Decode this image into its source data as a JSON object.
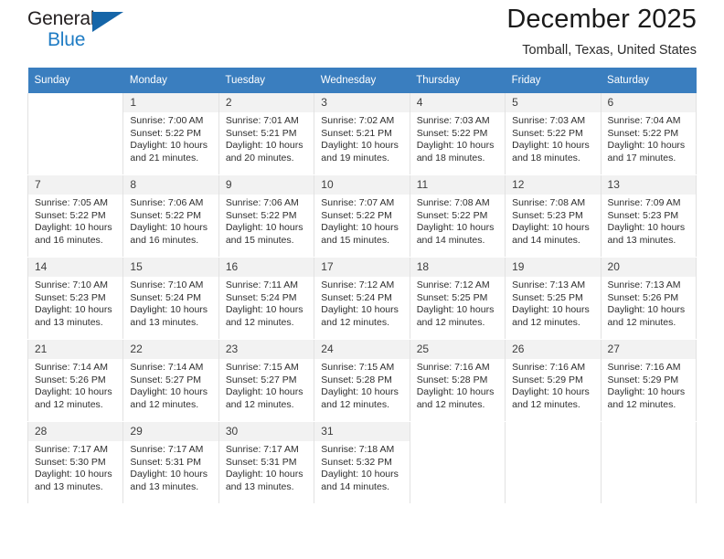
{
  "brand": {
    "name_part1": "General",
    "name_part2": "Blue",
    "triangle_color": "#1565a8",
    "blue_color": "#1f7cc4"
  },
  "header": {
    "title": "December 2025",
    "subtitle": "Tomball, Texas, United States"
  },
  "theme": {
    "header_row_bg": "#3a7ebf",
    "daynum_bg": "#f2f2f2",
    "cell_border": "#e2e2e2"
  },
  "weekday_headers": [
    "Sunday",
    "Monday",
    "Tuesday",
    "Wednesday",
    "Thursday",
    "Friday",
    "Saturday"
  ],
  "weeks": [
    [
      {
        "day": "",
        "sunrise": "",
        "sunset": "",
        "daylight": ""
      },
      {
        "day": "1",
        "sunrise": "Sunrise: 7:00 AM",
        "sunset": "Sunset: 5:22 PM",
        "daylight": "Daylight: 10 hours and 21 minutes."
      },
      {
        "day": "2",
        "sunrise": "Sunrise: 7:01 AM",
        "sunset": "Sunset: 5:21 PM",
        "daylight": "Daylight: 10 hours and 20 minutes."
      },
      {
        "day": "3",
        "sunrise": "Sunrise: 7:02 AM",
        "sunset": "Sunset: 5:21 PM",
        "daylight": "Daylight: 10 hours and 19 minutes."
      },
      {
        "day": "4",
        "sunrise": "Sunrise: 7:03 AM",
        "sunset": "Sunset: 5:22 PM",
        "daylight": "Daylight: 10 hours and 18 minutes."
      },
      {
        "day": "5",
        "sunrise": "Sunrise: 7:03 AM",
        "sunset": "Sunset: 5:22 PM",
        "daylight": "Daylight: 10 hours and 18 minutes."
      },
      {
        "day": "6",
        "sunrise": "Sunrise: 7:04 AM",
        "sunset": "Sunset: 5:22 PM",
        "daylight": "Daylight: 10 hours and 17 minutes."
      }
    ],
    [
      {
        "day": "7",
        "sunrise": "Sunrise: 7:05 AM",
        "sunset": "Sunset: 5:22 PM",
        "daylight": "Daylight: 10 hours and 16 minutes."
      },
      {
        "day": "8",
        "sunrise": "Sunrise: 7:06 AM",
        "sunset": "Sunset: 5:22 PM",
        "daylight": "Daylight: 10 hours and 16 minutes."
      },
      {
        "day": "9",
        "sunrise": "Sunrise: 7:06 AM",
        "sunset": "Sunset: 5:22 PM",
        "daylight": "Daylight: 10 hours and 15 minutes."
      },
      {
        "day": "10",
        "sunrise": "Sunrise: 7:07 AM",
        "sunset": "Sunset: 5:22 PM",
        "daylight": "Daylight: 10 hours and 15 minutes."
      },
      {
        "day": "11",
        "sunrise": "Sunrise: 7:08 AM",
        "sunset": "Sunset: 5:22 PM",
        "daylight": "Daylight: 10 hours and 14 minutes."
      },
      {
        "day": "12",
        "sunrise": "Sunrise: 7:08 AM",
        "sunset": "Sunset: 5:23 PM",
        "daylight": "Daylight: 10 hours and 14 minutes."
      },
      {
        "day": "13",
        "sunrise": "Sunrise: 7:09 AM",
        "sunset": "Sunset: 5:23 PM",
        "daylight": "Daylight: 10 hours and 13 minutes."
      }
    ],
    [
      {
        "day": "14",
        "sunrise": "Sunrise: 7:10 AM",
        "sunset": "Sunset: 5:23 PM",
        "daylight": "Daylight: 10 hours and 13 minutes."
      },
      {
        "day": "15",
        "sunrise": "Sunrise: 7:10 AM",
        "sunset": "Sunset: 5:24 PM",
        "daylight": "Daylight: 10 hours and 13 minutes."
      },
      {
        "day": "16",
        "sunrise": "Sunrise: 7:11 AM",
        "sunset": "Sunset: 5:24 PM",
        "daylight": "Daylight: 10 hours and 12 minutes."
      },
      {
        "day": "17",
        "sunrise": "Sunrise: 7:12 AM",
        "sunset": "Sunset: 5:24 PM",
        "daylight": "Daylight: 10 hours and 12 minutes."
      },
      {
        "day": "18",
        "sunrise": "Sunrise: 7:12 AM",
        "sunset": "Sunset: 5:25 PM",
        "daylight": "Daylight: 10 hours and 12 minutes."
      },
      {
        "day": "19",
        "sunrise": "Sunrise: 7:13 AM",
        "sunset": "Sunset: 5:25 PM",
        "daylight": "Daylight: 10 hours and 12 minutes."
      },
      {
        "day": "20",
        "sunrise": "Sunrise: 7:13 AM",
        "sunset": "Sunset: 5:26 PM",
        "daylight": "Daylight: 10 hours and 12 minutes."
      }
    ],
    [
      {
        "day": "21",
        "sunrise": "Sunrise: 7:14 AM",
        "sunset": "Sunset: 5:26 PM",
        "daylight": "Daylight: 10 hours and 12 minutes."
      },
      {
        "day": "22",
        "sunrise": "Sunrise: 7:14 AM",
        "sunset": "Sunset: 5:27 PM",
        "daylight": "Daylight: 10 hours and 12 minutes."
      },
      {
        "day": "23",
        "sunrise": "Sunrise: 7:15 AM",
        "sunset": "Sunset: 5:27 PM",
        "daylight": "Daylight: 10 hours and 12 minutes."
      },
      {
        "day": "24",
        "sunrise": "Sunrise: 7:15 AM",
        "sunset": "Sunset: 5:28 PM",
        "daylight": "Daylight: 10 hours and 12 minutes."
      },
      {
        "day": "25",
        "sunrise": "Sunrise: 7:16 AM",
        "sunset": "Sunset: 5:28 PM",
        "daylight": "Daylight: 10 hours and 12 minutes."
      },
      {
        "day": "26",
        "sunrise": "Sunrise: 7:16 AM",
        "sunset": "Sunset: 5:29 PM",
        "daylight": "Daylight: 10 hours and 12 minutes."
      },
      {
        "day": "27",
        "sunrise": "Sunrise: 7:16 AM",
        "sunset": "Sunset: 5:29 PM",
        "daylight": "Daylight: 10 hours and 12 minutes."
      }
    ],
    [
      {
        "day": "28",
        "sunrise": "Sunrise: 7:17 AM",
        "sunset": "Sunset: 5:30 PM",
        "daylight": "Daylight: 10 hours and 13 minutes."
      },
      {
        "day": "29",
        "sunrise": "Sunrise: 7:17 AM",
        "sunset": "Sunset: 5:31 PM",
        "daylight": "Daylight: 10 hours and 13 minutes."
      },
      {
        "day": "30",
        "sunrise": "Sunrise: 7:17 AM",
        "sunset": "Sunset: 5:31 PM",
        "daylight": "Daylight: 10 hours and 13 minutes."
      },
      {
        "day": "31",
        "sunrise": "Sunrise: 7:18 AM",
        "sunset": "Sunset: 5:32 PM",
        "daylight": "Daylight: 10 hours and 14 minutes."
      },
      {
        "day": "",
        "sunrise": "",
        "sunset": "",
        "daylight": ""
      },
      {
        "day": "",
        "sunrise": "",
        "sunset": "",
        "daylight": ""
      },
      {
        "day": "",
        "sunrise": "",
        "sunset": "",
        "daylight": ""
      }
    ]
  ]
}
